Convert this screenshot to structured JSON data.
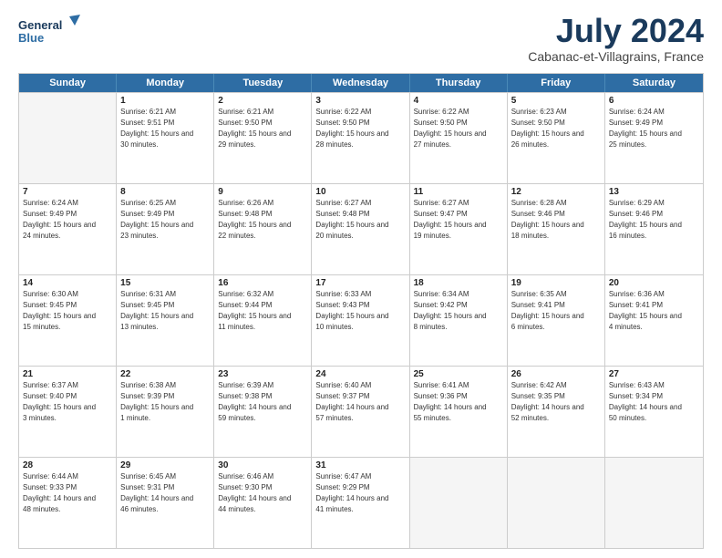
{
  "header": {
    "logo_line1": "General",
    "logo_line2": "Blue",
    "month": "July 2024",
    "location": "Cabanac-et-Villagrains, France"
  },
  "days_of_week": [
    "Sunday",
    "Monday",
    "Tuesday",
    "Wednesday",
    "Thursday",
    "Friday",
    "Saturday"
  ],
  "weeks": [
    [
      {
        "day": "",
        "empty": true
      },
      {
        "day": "1",
        "sunrise": "6:21 AM",
        "sunset": "9:51 PM",
        "daylight": "15 hours and 30 minutes."
      },
      {
        "day": "2",
        "sunrise": "6:21 AM",
        "sunset": "9:50 PM",
        "daylight": "15 hours and 29 minutes."
      },
      {
        "day": "3",
        "sunrise": "6:22 AM",
        "sunset": "9:50 PM",
        "daylight": "15 hours and 28 minutes."
      },
      {
        "day": "4",
        "sunrise": "6:22 AM",
        "sunset": "9:50 PM",
        "daylight": "15 hours and 27 minutes."
      },
      {
        "day": "5",
        "sunrise": "6:23 AM",
        "sunset": "9:50 PM",
        "daylight": "15 hours and 26 minutes."
      },
      {
        "day": "6",
        "sunrise": "6:24 AM",
        "sunset": "9:49 PM",
        "daylight": "15 hours and 25 minutes."
      }
    ],
    [
      {
        "day": "7",
        "sunrise": "6:24 AM",
        "sunset": "9:49 PM",
        "daylight": "15 hours and 24 minutes."
      },
      {
        "day": "8",
        "sunrise": "6:25 AM",
        "sunset": "9:49 PM",
        "daylight": "15 hours and 23 minutes."
      },
      {
        "day": "9",
        "sunrise": "6:26 AM",
        "sunset": "9:48 PM",
        "daylight": "15 hours and 22 minutes."
      },
      {
        "day": "10",
        "sunrise": "6:27 AM",
        "sunset": "9:48 PM",
        "daylight": "15 hours and 20 minutes."
      },
      {
        "day": "11",
        "sunrise": "6:27 AM",
        "sunset": "9:47 PM",
        "daylight": "15 hours and 19 minutes."
      },
      {
        "day": "12",
        "sunrise": "6:28 AM",
        "sunset": "9:46 PM",
        "daylight": "15 hours and 18 minutes."
      },
      {
        "day": "13",
        "sunrise": "6:29 AM",
        "sunset": "9:46 PM",
        "daylight": "15 hours and 16 minutes."
      }
    ],
    [
      {
        "day": "14",
        "sunrise": "6:30 AM",
        "sunset": "9:45 PM",
        "daylight": "15 hours and 15 minutes."
      },
      {
        "day": "15",
        "sunrise": "6:31 AM",
        "sunset": "9:45 PM",
        "daylight": "15 hours and 13 minutes."
      },
      {
        "day": "16",
        "sunrise": "6:32 AM",
        "sunset": "9:44 PM",
        "daylight": "15 hours and 11 minutes."
      },
      {
        "day": "17",
        "sunrise": "6:33 AM",
        "sunset": "9:43 PM",
        "daylight": "15 hours and 10 minutes."
      },
      {
        "day": "18",
        "sunrise": "6:34 AM",
        "sunset": "9:42 PM",
        "daylight": "15 hours and 8 minutes."
      },
      {
        "day": "19",
        "sunrise": "6:35 AM",
        "sunset": "9:41 PM",
        "daylight": "15 hours and 6 minutes."
      },
      {
        "day": "20",
        "sunrise": "6:36 AM",
        "sunset": "9:41 PM",
        "daylight": "15 hours and 4 minutes."
      }
    ],
    [
      {
        "day": "21",
        "sunrise": "6:37 AM",
        "sunset": "9:40 PM",
        "daylight": "15 hours and 3 minutes."
      },
      {
        "day": "22",
        "sunrise": "6:38 AM",
        "sunset": "9:39 PM",
        "daylight": "15 hours and 1 minute."
      },
      {
        "day": "23",
        "sunrise": "6:39 AM",
        "sunset": "9:38 PM",
        "daylight": "14 hours and 59 minutes."
      },
      {
        "day": "24",
        "sunrise": "6:40 AM",
        "sunset": "9:37 PM",
        "daylight": "14 hours and 57 minutes."
      },
      {
        "day": "25",
        "sunrise": "6:41 AM",
        "sunset": "9:36 PM",
        "daylight": "14 hours and 55 minutes."
      },
      {
        "day": "26",
        "sunrise": "6:42 AM",
        "sunset": "9:35 PM",
        "daylight": "14 hours and 52 minutes."
      },
      {
        "day": "27",
        "sunrise": "6:43 AM",
        "sunset": "9:34 PM",
        "daylight": "14 hours and 50 minutes."
      }
    ],
    [
      {
        "day": "28",
        "sunrise": "6:44 AM",
        "sunset": "9:33 PM",
        "daylight": "14 hours and 48 minutes."
      },
      {
        "day": "29",
        "sunrise": "6:45 AM",
        "sunset": "9:31 PM",
        "daylight": "14 hours and 46 minutes."
      },
      {
        "day": "30",
        "sunrise": "6:46 AM",
        "sunset": "9:30 PM",
        "daylight": "14 hours and 44 minutes."
      },
      {
        "day": "31",
        "sunrise": "6:47 AM",
        "sunset": "9:29 PM",
        "daylight": "14 hours and 41 minutes."
      },
      {
        "day": "",
        "empty": true
      },
      {
        "day": "",
        "empty": true
      },
      {
        "day": "",
        "empty": true
      }
    ]
  ]
}
